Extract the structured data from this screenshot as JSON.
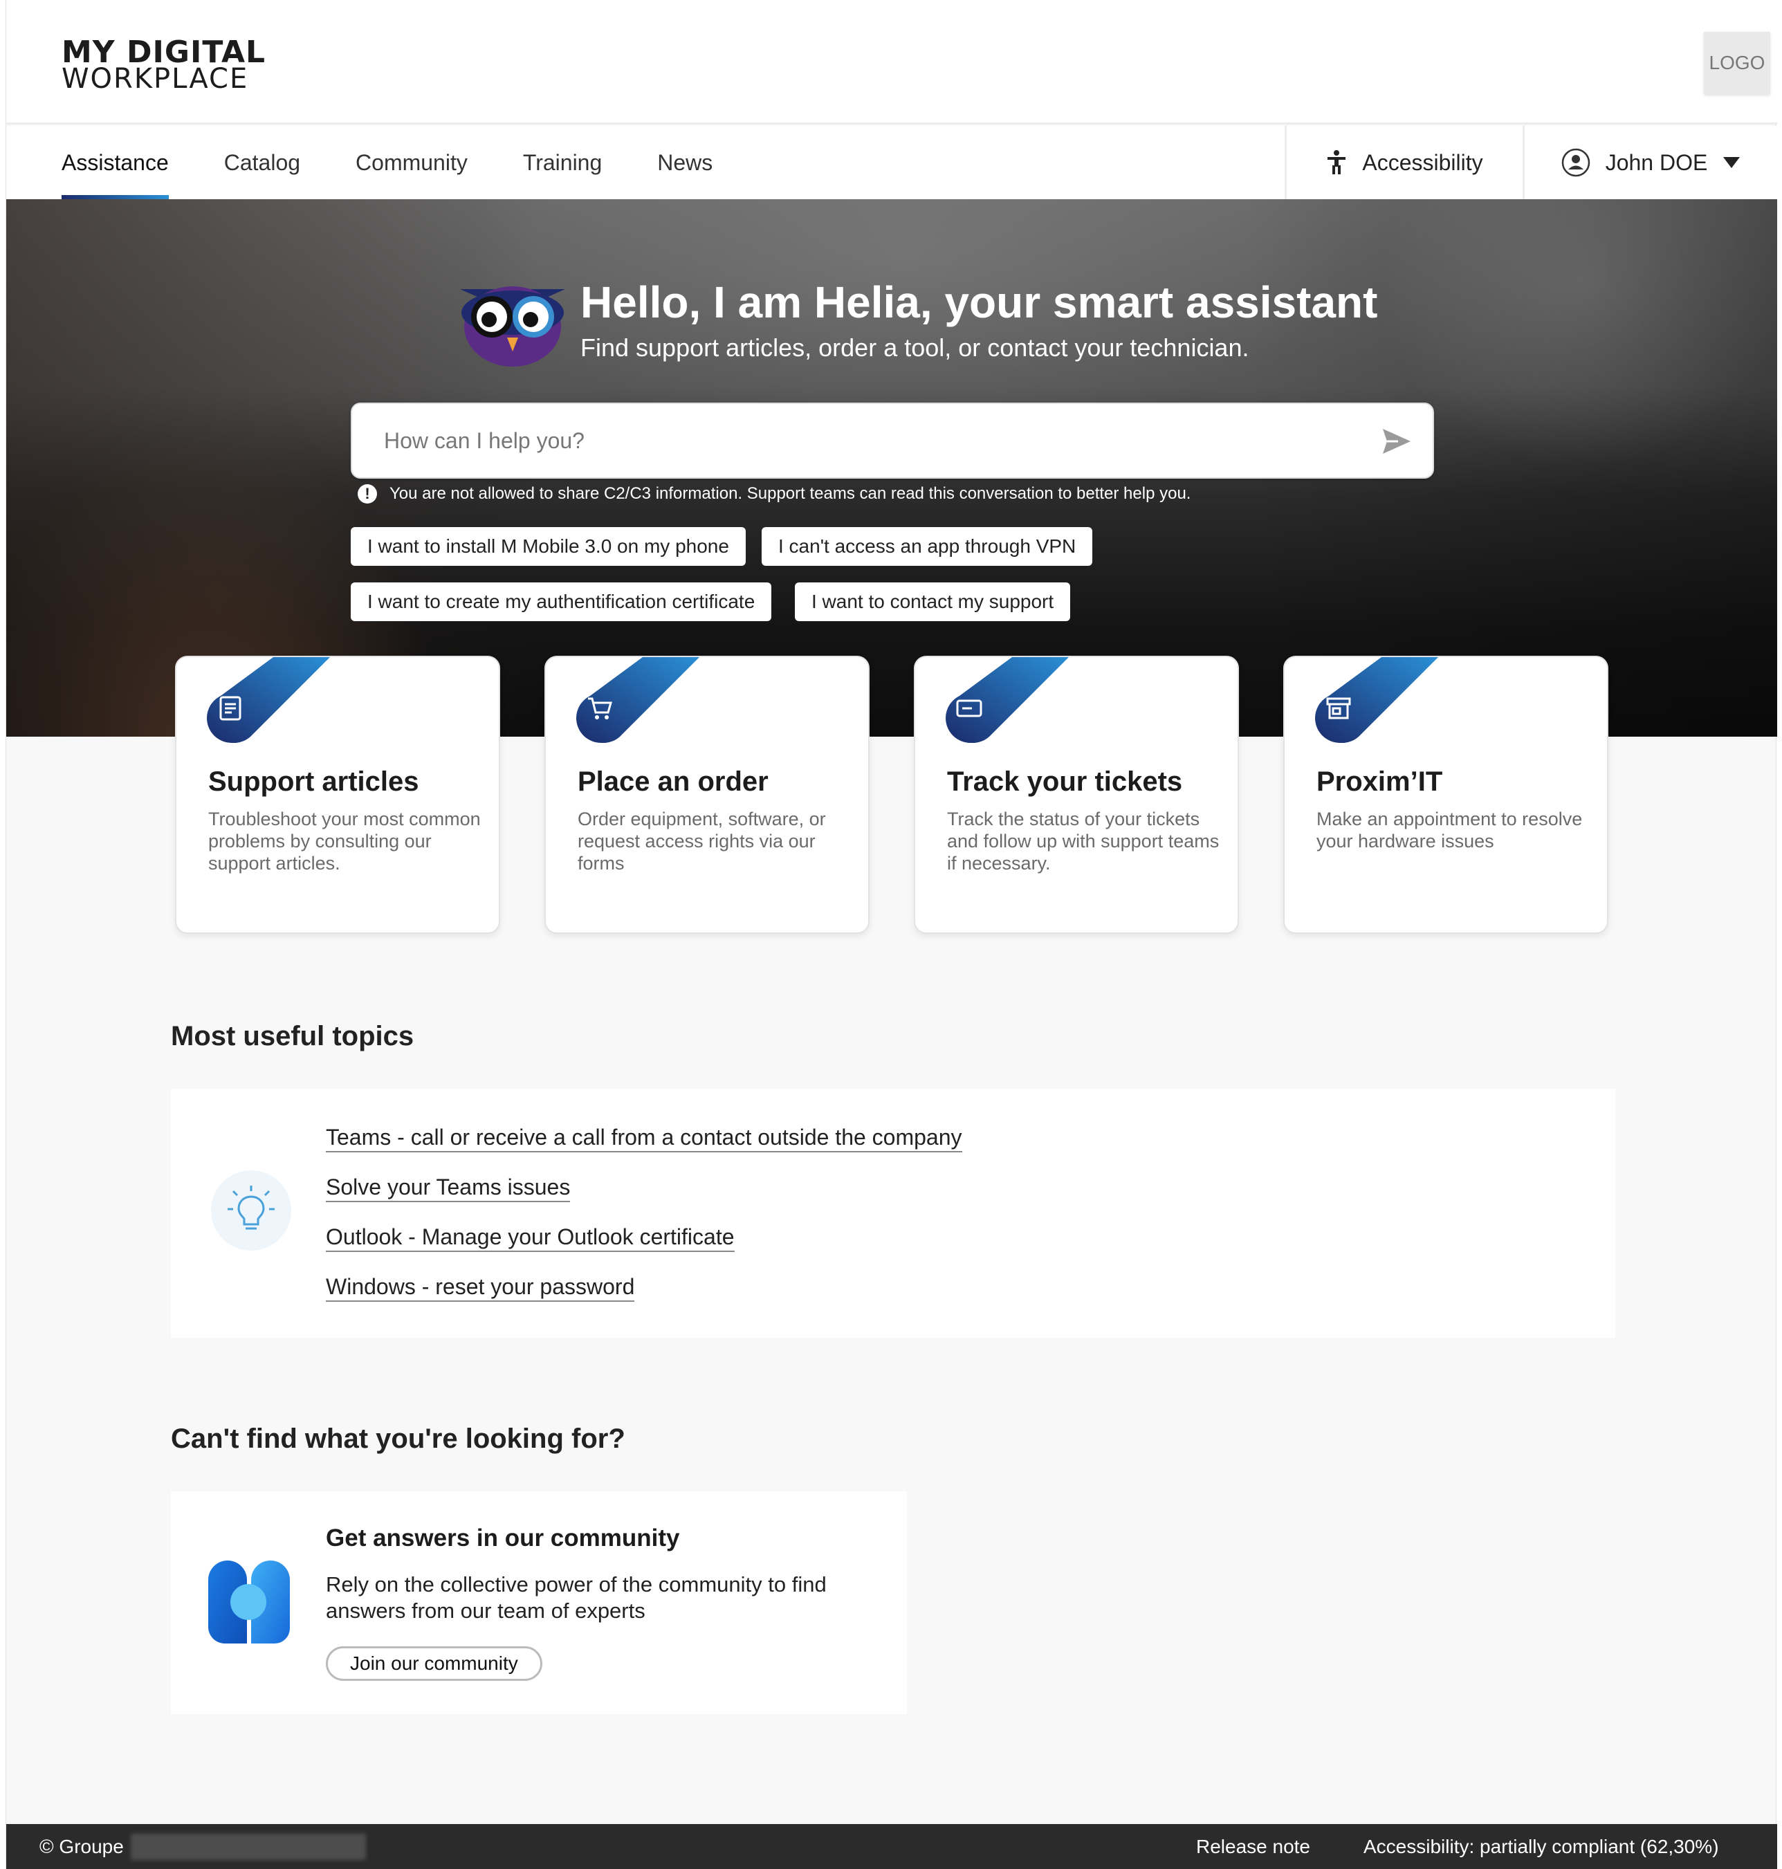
{
  "brand": {
    "line1": "MY DIGITAL",
    "line2": "WORKPLACE"
  },
  "logo_placeholder": "LOGO",
  "nav": {
    "items": [
      {
        "label": "Assistance",
        "active": true
      },
      {
        "label": "Catalog",
        "active": false
      },
      {
        "label": "Community",
        "active": false
      },
      {
        "label": "Training",
        "active": false
      },
      {
        "label": "News",
        "active": false
      }
    ],
    "accessibility_label": "Accessibility",
    "user_name": "John DOE"
  },
  "hero": {
    "title": "Hello, I am Helia, your smart assistant",
    "subtitle": "Find support articles, order a tool, or contact your technician.",
    "search_placeholder": "How can I help you?",
    "warning": "You are not allowed to share C2/C3 information. Support teams can read this conversation to better help you.",
    "suggestions": [
      "I want to install M Mobile 3.0 on my phone",
      "I can't access an app through VPN",
      "I want to create my authentification certificate",
      "I want to contact my support"
    ]
  },
  "cards": [
    {
      "title": "Support articles",
      "description": "Troubleshoot your most common problems by consulting our support articles.",
      "icon": "article-icon"
    },
    {
      "title": "Place an order",
      "description": "Order equipment, software, or request access rights via our forms",
      "icon": "cart-icon"
    },
    {
      "title": "Track your tickets",
      "description": "Track the status of your tickets and follow up with support teams if necessary.",
      "icon": "ticket-icon"
    },
    {
      "title": "Proxim’IT",
      "description": "Make an appointment to resolve your hardware issues",
      "icon": "store-icon"
    }
  ],
  "topics": {
    "title": "Most useful topics",
    "items": [
      "Teams - call or receive a call from a contact outside the company",
      "Solve your Teams issues",
      "Outlook - Manage your Outlook certificate",
      "Windows - reset your password"
    ]
  },
  "community": {
    "section_title": "Can't find what you're looking for?",
    "title": "Get answers in our community",
    "description": "Rely on the collective power of the community to find answers from our team of experts",
    "button": "Join our community"
  },
  "footer": {
    "copyright": "© Groupe",
    "release_note": "Release note",
    "accessibility": "Accessibility: partially compliant (62,30%)"
  },
  "colors": {
    "accent_dark": "#1b2b6b",
    "accent_light": "#2a8fd6",
    "footer_bg": "#2b2b2b"
  }
}
